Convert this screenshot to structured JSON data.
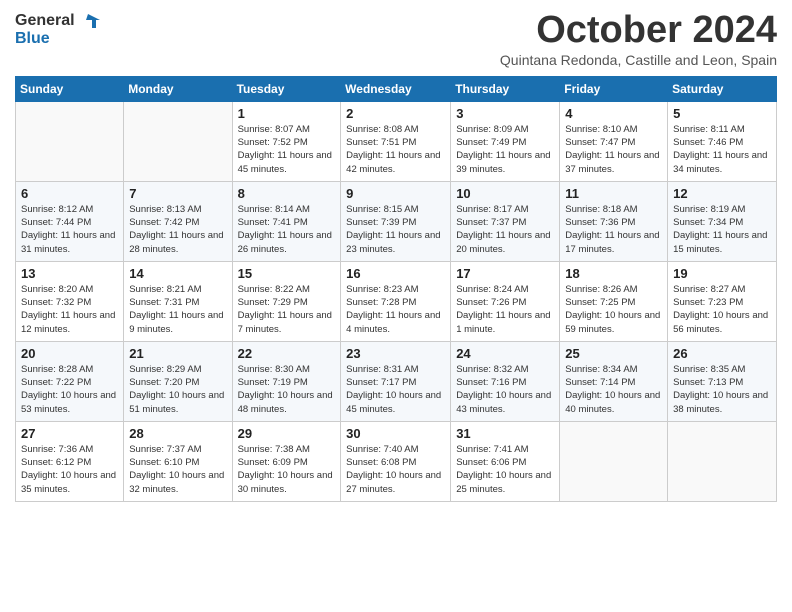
{
  "logo": {
    "line1": "General",
    "line2": "Blue"
  },
  "title": "October 2024",
  "subtitle": "Quintana Redonda, Castille and Leon, Spain",
  "days_of_week": [
    "Sunday",
    "Monday",
    "Tuesday",
    "Wednesday",
    "Thursday",
    "Friday",
    "Saturday"
  ],
  "weeks": [
    [
      {
        "day": "",
        "detail": ""
      },
      {
        "day": "",
        "detail": ""
      },
      {
        "day": "1",
        "detail": "Sunrise: 8:07 AM\nSunset: 7:52 PM\nDaylight: 11 hours and 45 minutes."
      },
      {
        "day": "2",
        "detail": "Sunrise: 8:08 AM\nSunset: 7:51 PM\nDaylight: 11 hours and 42 minutes."
      },
      {
        "day": "3",
        "detail": "Sunrise: 8:09 AM\nSunset: 7:49 PM\nDaylight: 11 hours and 39 minutes."
      },
      {
        "day": "4",
        "detail": "Sunrise: 8:10 AM\nSunset: 7:47 PM\nDaylight: 11 hours and 37 minutes."
      },
      {
        "day": "5",
        "detail": "Sunrise: 8:11 AM\nSunset: 7:46 PM\nDaylight: 11 hours and 34 minutes."
      }
    ],
    [
      {
        "day": "6",
        "detail": "Sunrise: 8:12 AM\nSunset: 7:44 PM\nDaylight: 11 hours and 31 minutes."
      },
      {
        "day": "7",
        "detail": "Sunrise: 8:13 AM\nSunset: 7:42 PM\nDaylight: 11 hours and 28 minutes."
      },
      {
        "day": "8",
        "detail": "Sunrise: 8:14 AM\nSunset: 7:41 PM\nDaylight: 11 hours and 26 minutes."
      },
      {
        "day": "9",
        "detail": "Sunrise: 8:15 AM\nSunset: 7:39 PM\nDaylight: 11 hours and 23 minutes."
      },
      {
        "day": "10",
        "detail": "Sunrise: 8:17 AM\nSunset: 7:37 PM\nDaylight: 11 hours and 20 minutes."
      },
      {
        "day": "11",
        "detail": "Sunrise: 8:18 AM\nSunset: 7:36 PM\nDaylight: 11 hours and 17 minutes."
      },
      {
        "day": "12",
        "detail": "Sunrise: 8:19 AM\nSunset: 7:34 PM\nDaylight: 11 hours and 15 minutes."
      }
    ],
    [
      {
        "day": "13",
        "detail": "Sunrise: 8:20 AM\nSunset: 7:32 PM\nDaylight: 11 hours and 12 minutes."
      },
      {
        "day": "14",
        "detail": "Sunrise: 8:21 AM\nSunset: 7:31 PM\nDaylight: 11 hours and 9 minutes."
      },
      {
        "day": "15",
        "detail": "Sunrise: 8:22 AM\nSunset: 7:29 PM\nDaylight: 11 hours and 7 minutes."
      },
      {
        "day": "16",
        "detail": "Sunrise: 8:23 AM\nSunset: 7:28 PM\nDaylight: 11 hours and 4 minutes."
      },
      {
        "day": "17",
        "detail": "Sunrise: 8:24 AM\nSunset: 7:26 PM\nDaylight: 11 hours and 1 minute."
      },
      {
        "day": "18",
        "detail": "Sunrise: 8:26 AM\nSunset: 7:25 PM\nDaylight: 10 hours and 59 minutes."
      },
      {
        "day": "19",
        "detail": "Sunrise: 8:27 AM\nSunset: 7:23 PM\nDaylight: 10 hours and 56 minutes."
      }
    ],
    [
      {
        "day": "20",
        "detail": "Sunrise: 8:28 AM\nSunset: 7:22 PM\nDaylight: 10 hours and 53 minutes."
      },
      {
        "day": "21",
        "detail": "Sunrise: 8:29 AM\nSunset: 7:20 PM\nDaylight: 10 hours and 51 minutes."
      },
      {
        "day": "22",
        "detail": "Sunrise: 8:30 AM\nSunset: 7:19 PM\nDaylight: 10 hours and 48 minutes."
      },
      {
        "day": "23",
        "detail": "Sunrise: 8:31 AM\nSunset: 7:17 PM\nDaylight: 10 hours and 45 minutes."
      },
      {
        "day": "24",
        "detail": "Sunrise: 8:32 AM\nSunset: 7:16 PM\nDaylight: 10 hours and 43 minutes."
      },
      {
        "day": "25",
        "detail": "Sunrise: 8:34 AM\nSunset: 7:14 PM\nDaylight: 10 hours and 40 minutes."
      },
      {
        "day": "26",
        "detail": "Sunrise: 8:35 AM\nSunset: 7:13 PM\nDaylight: 10 hours and 38 minutes."
      }
    ],
    [
      {
        "day": "27",
        "detail": "Sunrise: 7:36 AM\nSunset: 6:12 PM\nDaylight: 10 hours and 35 minutes."
      },
      {
        "day": "28",
        "detail": "Sunrise: 7:37 AM\nSunset: 6:10 PM\nDaylight: 10 hours and 32 minutes."
      },
      {
        "day": "29",
        "detail": "Sunrise: 7:38 AM\nSunset: 6:09 PM\nDaylight: 10 hours and 30 minutes."
      },
      {
        "day": "30",
        "detail": "Sunrise: 7:40 AM\nSunset: 6:08 PM\nDaylight: 10 hours and 27 minutes."
      },
      {
        "day": "31",
        "detail": "Sunrise: 7:41 AM\nSunset: 6:06 PM\nDaylight: 10 hours and 25 minutes."
      },
      {
        "day": "",
        "detail": ""
      },
      {
        "day": "",
        "detail": ""
      }
    ]
  ]
}
